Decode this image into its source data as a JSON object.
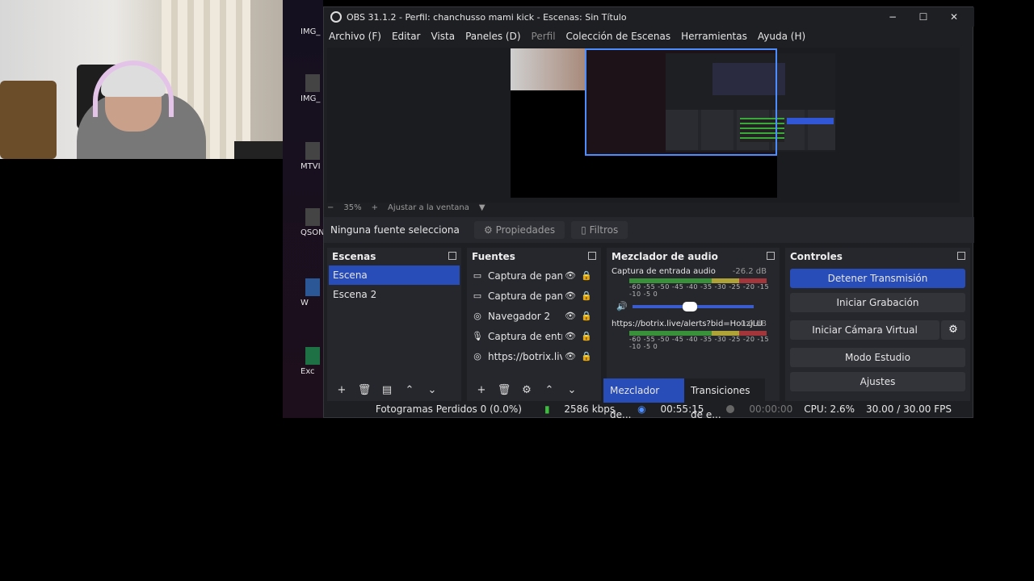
{
  "window": {
    "title": "OBS 31.1.2 - Perfil: chanchusso mami kick - Escenas: Sin Título",
    "controls": [
      "−",
      "☐",
      "✕"
    ]
  },
  "desktop_icons": [
    "IMG_",
    "IMG_",
    "MTVI",
    "QSON",
    "W",
    "Exc"
  ],
  "menu": [
    "Archivo (F)",
    "Editar",
    "Vista",
    "Paneles (D)",
    "Perfil",
    "Colección de Escenas",
    "Herramientas",
    "Ayuda (H)"
  ],
  "zoom": {
    "minus": "−",
    "value": "35%",
    "plus": "+",
    "fit": "Ajustar a la ventana",
    "arrow": "▼"
  },
  "infobar": {
    "no_source": "Ninguna fuente selecciona",
    "properties": "⚙ Propiedades",
    "filters": "▯ Filtros"
  },
  "scenes": {
    "title": "Escenas",
    "items": [
      "Escena",
      "Escena 2"
    ]
  },
  "sources": {
    "title": "Fuentes",
    "items": [
      {
        "icon": "▭",
        "name": "Captura de pantal"
      },
      {
        "icon": "▭",
        "name": "Captura de pantal"
      },
      {
        "icon": "◎",
        "name": "Navegador 2"
      },
      {
        "icon": "🎙",
        "name": "Captura de entrad"
      },
      {
        "icon": "◎",
        "name": "https://botrix.live/"
      }
    ]
  },
  "mixer": {
    "title": "Mezclador de audio",
    "channels": [
      {
        "name": "Captura de entrada audio",
        "db": "-26.2 dB"
      },
      {
        "name": "https://botrix.live/alerts?bid=Ho1zjLU",
        "db": "0.0 dB"
      }
    ],
    "scale": "-60 -55 -50 -45 -40 -35 -30 -25 -20 -15 -10 -5 0",
    "tabs": [
      "Mezclador de...",
      "Transiciones de e..."
    ]
  },
  "controls": {
    "title": "Controles",
    "stop_stream": "Detener Transmisión",
    "start_recording": "Iniciar Grabación",
    "virtual_camera": "Iniciar Cámara Virtual",
    "studio_mode": "Modo Estudio",
    "settings": "Ajustes"
  },
  "status": {
    "dropped": "Fotogramas Perdidos 0 (0.0%)",
    "bitrate": "2586 kbps",
    "stream_time": "00:55:15",
    "rec_time": "00:00:00",
    "cpu": "CPU: 2.6%",
    "fps": "30.00 / 30.00 FPS"
  },
  "colors": {
    "accent": "#284cb8",
    "selection": "#4c8dff",
    "bg": "#1e1f23",
    "panel": "#26272c"
  }
}
